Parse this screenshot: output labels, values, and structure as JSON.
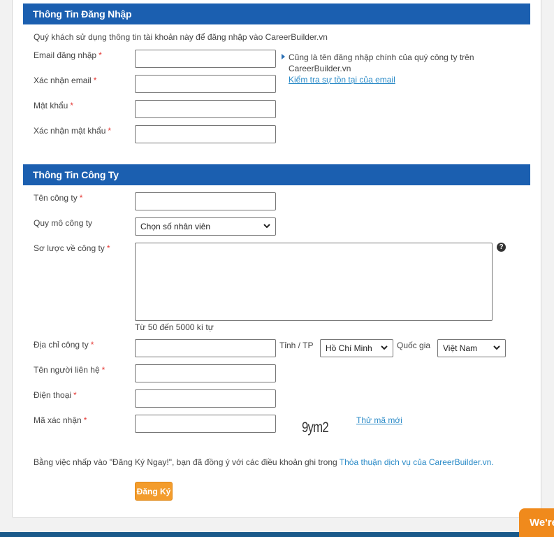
{
  "login_section": {
    "title": "Thông Tin Đăng Nhập",
    "intro": "Quý khách sử dụng thông tin tài khoản này để đăng nhập vào CareerBuilder.vn",
    "fields": [
      {
        "label": "Email đăng nhập",
        "required": "*",
        "value": ""
      },
      {
        "label": "Xác nhận email",
        "required": "*",
        "value": ""
      },
      {
        "label": "Mật khẩu",
        "required": "*",
        "value": ""
      },
      {
        "label": "Xác nhận mật khẩu",
        "required": "*",
        "value": ""
      }
    ],
    "email_hint_line1": "Cũng là tên đăng nhập chính của quý công ty trên",
    "email_hint_line2": "CareerBuilder.vn",
    "check_email_link": "Kiểm tra sự tồn tại của email"
  },
  "company_section": {
    "title": "Thông Tin Công Ty",
    "company_name": {
      "label": "Tên công ty",
      "required": "*",
      "value": ""
    },
    "company_size": {
      "label": "Quy mô công ty",
      "selected": "Chọn số nhân viên"
    },
    "company_profile": {
      "label": "Sơ lược về công ty",
      "required": "*",
      "value": "",
      "hint": "Từ 50 đến 5000 kí tự",
      "help_icon": "?"
    },
    "address": {
      "label": "Địa chỉ công ty",
      "required": "*",
      "value": ""
    },
    "province": {
      "label": "Tỉnh / TP",
      "selected": "Hồ Chí Minh"
    },
    "country": {
      "label": "Quốc gia",
      "selected": "Việt Nam"
    },
    "contact_name": {
      "label": "Tên người liên hệ",
      "required": "*",
      "value": ""
    },
    "phone": {
      "label": "Điện thoại",
      "required": "*",
      "value": ""
    },
    "captcha": {
      "label": "Mã xác nhận",
      "required": "*",
      "value": "",
      "image_text": "9ym2",
      "refresh_link": "Thử mã mới"
    }
  },
  "terms": {
    "prefix": "Bằng việc nhấp vào \"Đăng Ký Ngay!\", bạn đã đồng ý với các điều khoản ghi trong ",
    "link": "Thỏa thuận dịch vụ của CareerBuilder.vn."
  },
  "submit_label": "Đăng Ký",
  "chat_widget_label": "We're"
}
